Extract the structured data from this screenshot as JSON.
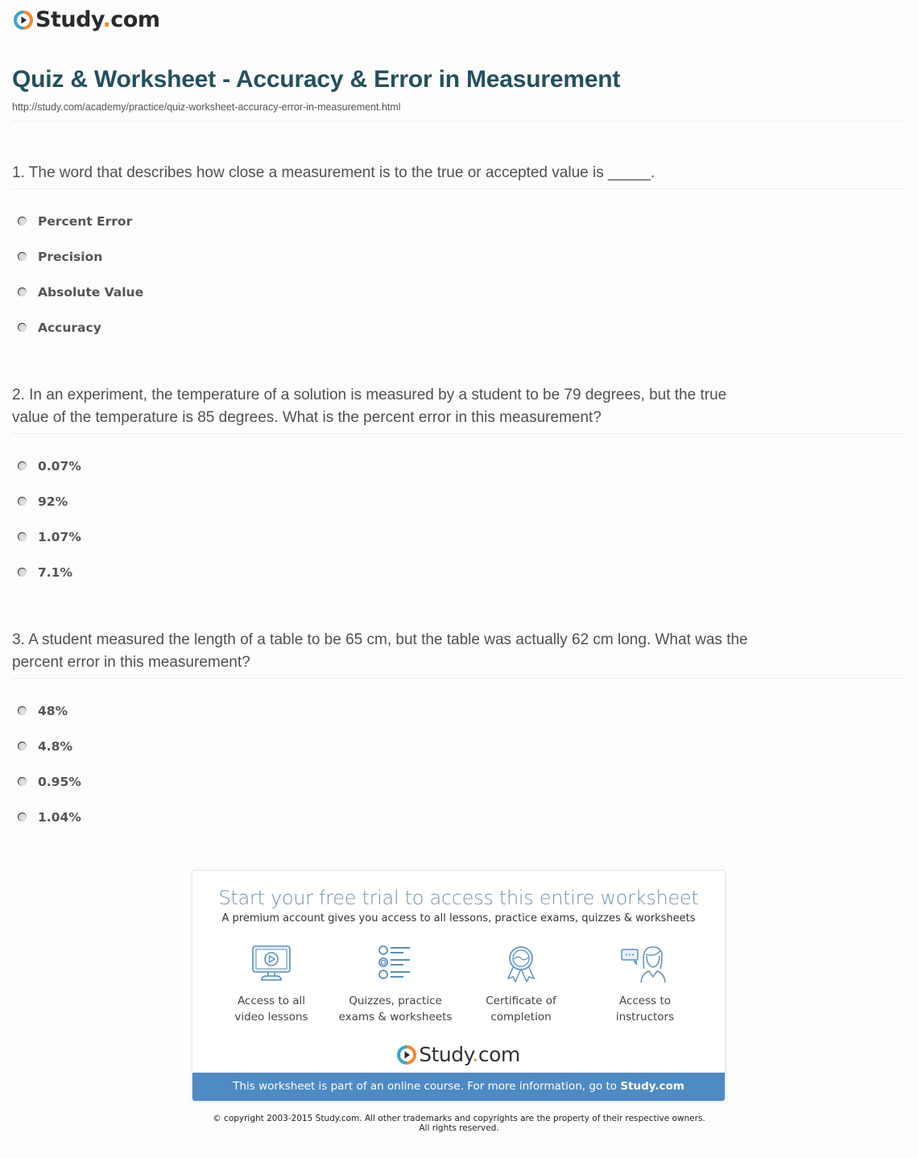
{
  "header": {
    "logo_text_main": "Study",
    "logo_text_dot": ".",
    "logo_text_tld": "com",
    "title": "Quiz & Worksheet - Accuracy & Error in Measurement",
    "url": "http://study.com/academy/practice/quiz-worksheet-accuracy-error-in-measurement.html"
  },
  "questions": [
    {
      "text": "1. The word that describes how close a measurement is to the true or accepted value is _____.",
      "options": [
        "Percent Error",
        "Precision",
        "Absolute Value",
        "Accuracy"
      ]
    },
    {
      "text": "2. In an experiment, the temperature of a solution is measured by a student to be 79 degrees, but the true value of the temperature is 85 degrees. What is the percent error in this measurement?",
      "options": [
        "0.07%",
        "92%",
        "1.07%",
        "7.1%"
      ]
    },
    {
      "text": "3. A student measured the length of a table to be 65 cm, but the table was actually 62 cm long. What was the percent error in this measurement?",
      "options": [
        "48%",
        "4.8%",
        "0.95%",
        "1.04%"
      ]
    }
  ],
  "promo": {
    "title": "Start your free trial to access this entire worksheet",
    "subtitle": "A premium account gives you access to all lessons, practice exams, quizzes & worksheets",
    "features": [
      {
        "icon": "monitor-play-icon",
        "line1": "Access to all",
        "line2": "video lessons"
      },
      {
        "icon": "quiz-list-icon",
        "line1": "Quizzes, practice",
        "line2": "exams & worksheets"
      },
      {
        "icon": "certificate-ribbon-icon",
        "line1": "Certificate of",
        "line2": "completion"
      },
      {
        "icon": "instructor-chat-icon",
        "line1": "Access to",
        "line2": "instructors"
      }
    ],
    "banner_text": "This worksheet is part of an online course. For more information, go to ",
    "banner_link": "Study.com"
  },
  "footer": {
    "copyright_line1": "© copyright 2003-2015 Study.com. All other trademarks and copyrights are the property of their respective owners.",
    "copyright_line2": "All rights reserved."
  },
  "colors": {
    "title": "#24505e",
    "brand_orange": "#f2892f",
    "brand_teal": "#3aa6c9",
    "banner_blue": "#4e8ac4",
    "icon_blue": "#5b8fbe"
  }
}
